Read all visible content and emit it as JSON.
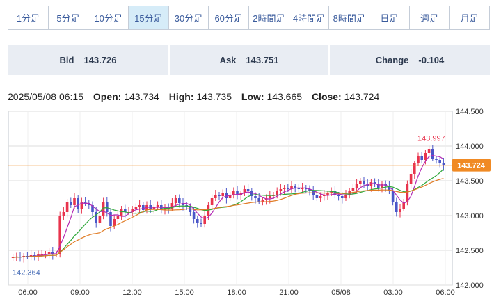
{
  "tabs": [
    "1分足",
    "5分足",
    "10分足",
    "15分足",
    "30分足",
    "60分足",
    "2時間足",
    "4時間足",
    "8時間足",
    "日足",
    "週足",
    "月足"
  ],
  "active_tab": "15分足",
  "quote": {
    "bid_label": "Bid",
    "bid": "143.726",
    "ask_label": "Ask",
    "ask": "143.751",
    "change_label": "Change",
    "change": "-0.104"
  },
  "ohlc": {
    "datetime": "2025/05/08 06:15",
    "open_label": "Open:",
    "open": "143.734",
    "high_label": "High:",
    "high": "143.735",
    "low_label": "Low:",
    "low": "143.665",
    "close_label": "Close:",
    "close": "143.724"
  },
  "colors": {
    "up": "#e8344d",
    "down": "#4a56c8",
    "ma_short": "#b42bb5",
    "ma_mid": "#2fa83a",
    "ma_long": "#e07a22",
    "price_line": "#f08a24",
    "grid": "#dddddd"
  },
  "chart_data": {
    "type": "candlestick",
    "ylim": [
      142.0,
      144.5
    ],
    "y_ticks": [
      "144.500",
      "144.000",
      "143.500",
      "143.000",
      "142.500",
      "142.000"
    ],
    "x_ticks": [
      "06:00",
      "09:00",
      "12:00",
      "15:00",
      "18:00",
      "21:00",
      "05/08",
      "03:00",
      "06:00"
    ],
    "current_price": "143.724",
    "high_label": "143.997",
    "low_label": "142.364",
    "close": [
      142.4,
      142.41,
      142.4,
      142.42,
      142.41,
      142.43,
      142.42,
      142.44,
      142.44,
      142.45,
      142.48,
      142.44,
      142.45,
      143.0,
      143.05,
      143.2,
      143.15,
      143.25,
      143.1,
      143.2,
      143.18,
      143.15,
      143.05,
      142.9,
      143.0,
      143.2,
      143.05,
      142.85,
      142.95,
      143.0,
      143.1,
      143.05,
      143.05,
      143.1,
      143.12,
      143.15,
      143.08,
      143.15,
      143.1,
      143.12,
      143.15,
      143.08,
      143.12,
      143.1,
      143.18,
      143.25,
      143.18,
      143.15,
      143.12,
      143.05,
      142.95,
      142.9,
      142.88,
      143.0,
      143.15,
      143.25,
      143.3,
      143.28,
      143.32,
      143.25,
      143.3,
      143.35,
      143.3,
      143.32,
      143.38,
      143.35,
      143.28,
      143.25,
      143.2,
      143.22,
      143.25,
      143.28,
      143.3,
      143.35,
      143.38,
      143.4,
      143.38,
      143.42,
      143.4,
      143.38,
      143.4,
      143.38,
      143.35,
      143.3,
      143.25,
      143.28,
      143.3,
      143.32,
      143.35,
      143.3,
      143.28,
      143.25,
      143.3,
      143.35,
      143.4,
      143.45,
      143.5,
      143.45,
      143.42,
      143.48,
      143.45,
      143.4,
      143.45,
      143.42,
      143.35,
      143.2,
      143.05,
      143.1,
      143.2,
      143.45,
      143.6,
      143.75,
      143.85,
      143.8,
      143.9,
      143.95,
      143.82,
      143.8,
      143.76,
      143.72
    ]
  }
}
